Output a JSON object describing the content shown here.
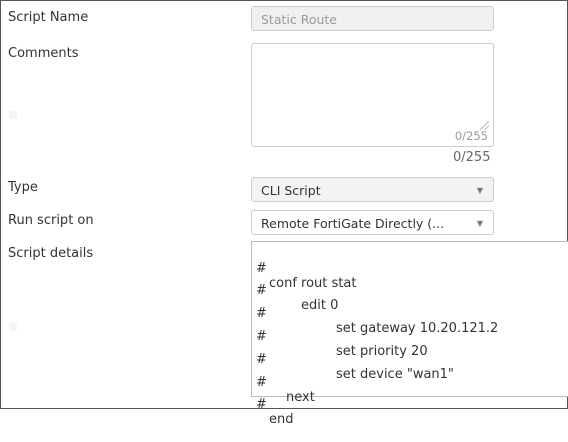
{
  "form": {
    "script_name": {
      "label": "Script Name",
      "value": "Static Route"
    },
    "comments": {
      "label": "Comments",
      "inner_counter": "0/255",
      "outer_counter": "0/255"
    },
    "type": {
      "label": "Type",
      "value": "CLI Script"
    },
    "run_on": {
      "label": "Run script on",
      "value": "Remote FortiGate Directly (..."
    },
    "script_details": {
      "label": "Script details",
      "lines": [
        {
          "hash": "#",
          "code": "conf rout stat"
        },
        {
          "hash": "#",
          "code": "edit 0"
        },
        {
          "hash": "#",
          "code": "set gateway 10.20.121.2"
        },
        {
          "hash": "#",
          "code": "set priority 20"
        },
        {
          "hash": "#",
          "code": "set device \"wan1\""
        },
        {
          "hash": "#",
          "code": "next"
        },
        {
          "hash": "#",
          "code": "end"
        }
      ]
    }
  },
  "icons": {
    "dropdown_caret": "chevron-down-icon",
    "resize_handle": "resize-grip-icon"
  }
}
